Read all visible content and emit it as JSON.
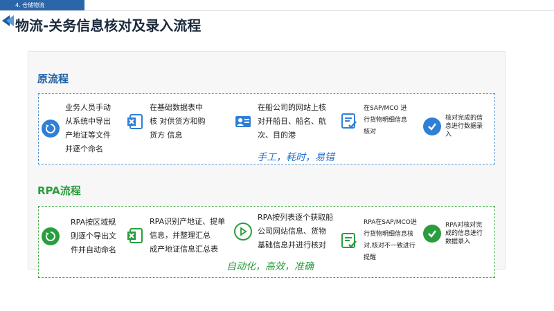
{
  "header": {
    "section_tag": "4. 仓储物流",
    "title": "物流-关务信息核对及录入流程"
  },
  "original": {
    "label": "原流程",
    "steps": [
      {
        "icon": "refresh-icon",
        "lines": [
          "业务人员手动",
          "从系统中导出",
          "产地证等文件",
          "并逐个命名"
        ]
      },
      {
        "icon": "excel-icon",
        "lines": [
          "在基础数据表中",
          "核    对供货方和购",
          "货方  信息"
        ]
      },
      {
        "icon": "person-card-icon",
        "lines": [
          "在船公司的网站上核",
          "对开船日、船名、航",
          "次、目的港"
        ]
      },
      {
        "icon": "checklist-icon",
        "lines": [
          "在SAP/MCO 进",
          "行货物明细信息",
          "核对"
        ]
      },
      {
        "icon": "check-circle-icon",
        "lines": [
          "核对完成的信",
          "息进行数据录",
          "入"
        ]
      }
    ],
    "note": "手工，耗时，易错"
  },
  "rpa": {
    "label": "RPA流程",
    "steps": [
      {
        "icon": "refresh-icon",
        "lines": [
          "RPA按区域规",
          "则逐个导出文",
          "件并自动命名"
        ]
      },
      {
        "icon": "excel-icon",
        "lines": [
          "RPA识别产地证、提单",
          "信息，并整理汇总",
          "成产地证信息汇总表"
        ]
      },
      {
        "icon": "play-icon",
        "lines": [
          "RPA按列表逐个获取船",
          "公司网站信息、货物",
          "基础信息并进行核对"
        ]
      },
      {
        "icon": "checklist-icon",
        "lines": [
          "RPA在SAP/MCO进",
          "行货物明细信息核",
          "对,核对不一致进行",
          "提醒"
        ]
      },
      {
        "icon": "check-circle-icon",
        "lines": [
          "RPA对核对完",
          "成的信息进行",
          "数据录入"
        ]
      }
    ],
    "note": "自动化，高效，准确"
  },
  "colors": {
    "blue": "#1f5fa6",
    "green": "#2a9d3e",
    "excel": "#1e8e3e",
    "icon_blue": "#2f7fd6"
  }
}
